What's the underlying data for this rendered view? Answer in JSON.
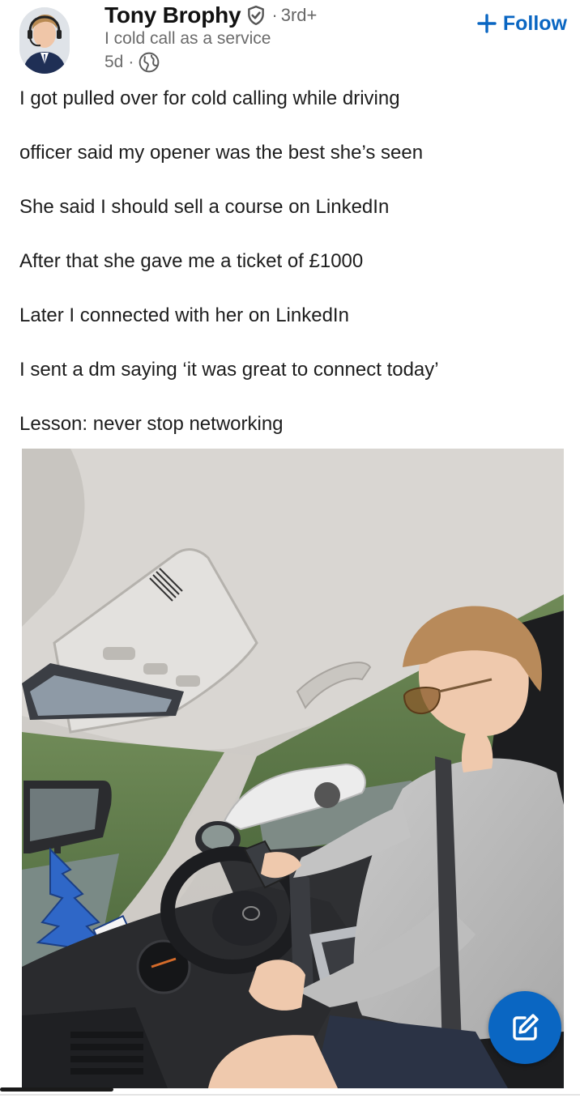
{
  "author": {
    "name": "Tony Brophy",
    "degree": "3rd+",
    "separator": "·",
    "headline": "I cold call as a service",
    "time": "5d",
    "meta_separator": "·",
    "icons": [
      "verified-icon",
      "globe-icon",
      "avatar-photo"
    ]
  },
  "follow": {
    "label": "Follow",
    "icon": "plus-icon"
  },
  "post": {
    "lines": [
      "I got pulled over for cold calling while driving",
      "officer said my opener was the best she’s seen",
      "She said I should sell a course on LinkedIn",
      "After that she gave me a ticket of £1000",
      "Later I connected with her on LinkedIn",
      "I sent a dm saying ‘it was great to connect today’",
      "Lesson: never stop networking"
    ],
    "image_icon": "car-interior-photo"
  },
  "fab": {
    "icon": "compose-icon"
  },
  "colors": {
    "accent": "#0a66c2",
    "text": "#1d1d1d",
    "muted": "#6b6b6b"
  }
}
